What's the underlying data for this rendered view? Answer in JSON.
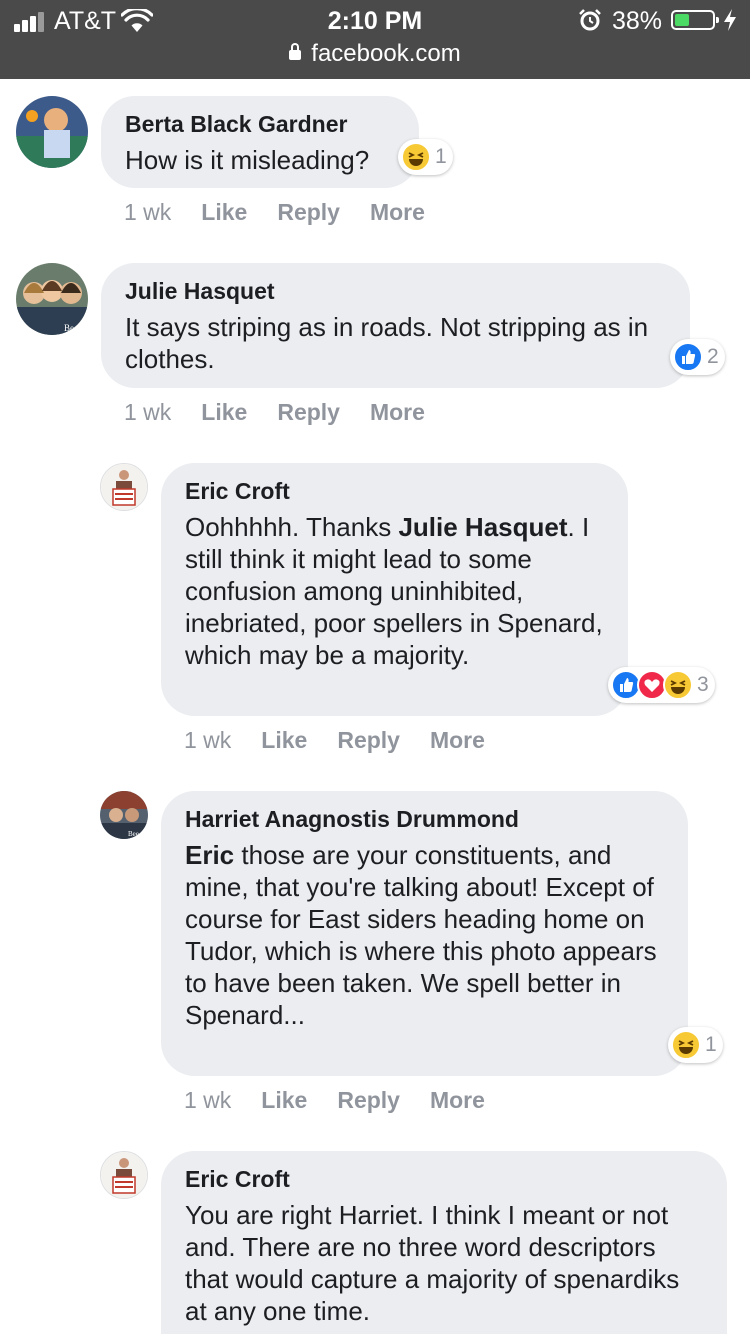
{
  "status_bar": {
    "carrier": "AT&T",
    "time": "2:10 PM",
    "battery_percent": "38%",
    "battery_level": 0.38,
    "icons": [
      "signal-icon",
      "wifi-icon",
      "alarm-icon",
      "battery-icon",
      "charging-bolt-icon"
    ]
  },
  "browser": {
    "url": "facebook.com",
    "icons": [
      "lock-icon"
    ]
  },
  "comments": [
    {
      "author": "Berta Black Gardner",
      "text": "How is it misleading?",
      "reactions": {
        "types": [
          "haha"
        ],
        "count": "1"
      },
      "time": "1 wk",
      "like": "Like",
      "reply": "Reply",
      "more": "More"
    },
    {
      "author": "Julie Hasquet",
      "text": "It says striping as in roads. Not stripping as in clothes.",
      "reactions": {
        "types": [
          "like"
        ],
        "count": "2"
      },
      "time": "1 wk",
      "like": "Like",
      "reply": "Reply",
      "more": "More"
    },
    {
      "author": "Eric Croft",
      "mention": "Julie Hasquet",
      "pre_mention": "Oohhhhh. Thanks ",
      "text": ". I still think it might lead to some confusion among uninhibited, inebriated, poor spellers in Spenard, which may be a majority.",
      "reactions": {
        "types": [
          "like",
          "love",
          "haha"
        ],
        "count": "3"
      },
      "time": "1 wk",
      "like": "Like",
      "reply": "Reply",
      "more": "More"
    },
    {
      "author": "Harriet Anagnostis Drummond",
      "mention": "Eric",
      "text": " those are your constituents, and mine, that you're talking about! Except of course for East siders heading home on Tudor, which is where this photo appears to have been taken. We spell better in Spenard...",
      "reactions": {
        "types": [
          "haha"
        ],
        "count": "1"
      },
      "time": "1 wk",
      "like": "Like",
      "reply": "Reply",
      "more": "More"
    },
    {
      "author": "Eric Croft",
      "text": "You are right Harriet. I think I meant or not and. There are no three word descriptors that would capture a majority of spenardiks at any one time."
    }
  ]
}
